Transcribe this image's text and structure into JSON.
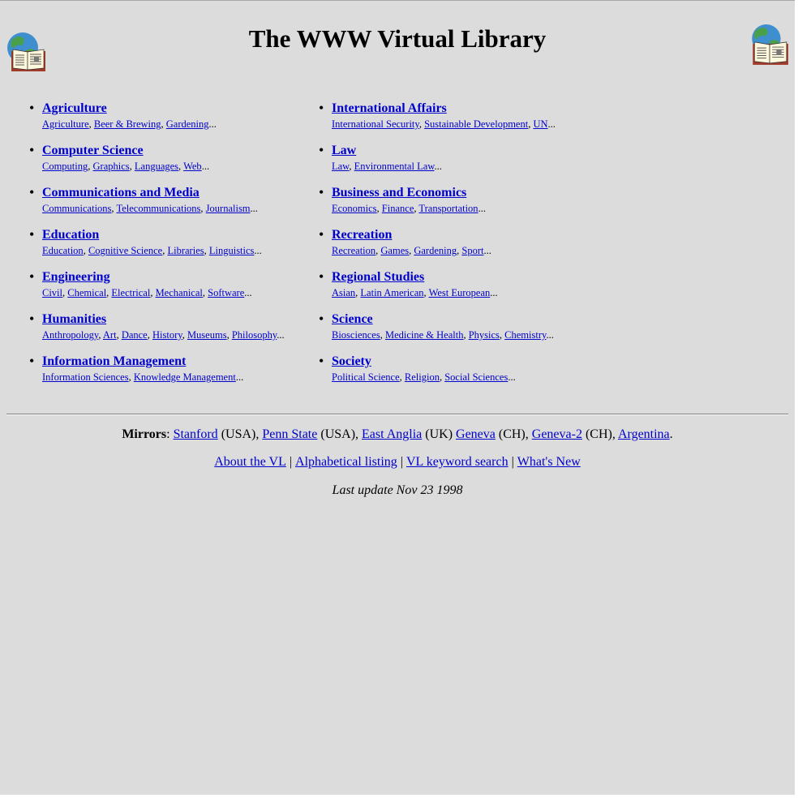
{
  "title": "The WWW Virtual Library",
  "icons": {
    "left": "globe-book-icon",
    "right": "globe-book-icon"
  },
  "colors": {
    "background": "#dcdcdc",
    "link": "#0000cc"
  },
  "categories_left": [
    {
      "title": "Agriculture",
      "subs": [
        "Agriculture",
        "Beer & Brewing",
        "Gardening"
      ]
    },
    {
      "title": "Computer Science",
      "subs": [
        "Computing",
        "Graphics",
        "Languages",
        "Web"
      ]
    },
    {
      "title": "Communications and Media",
      "subs": [
        "Communications",
        "Telecommunications",
        "Journalism"
      ]
    },
    {
      "title": "Education",
      "subs": [
        "Education",
        "Cognitive Science",
        "Libraries",
        "Linguistics"
      ]
    },
    {
      "title": "Engineering",
      "subs": [
        "Civil",
        "Chemical",
        "Electrical",
        "Mechanical",
        "Software"
      ]
    },
    {
      "title": "Humanities",
      "subs": [
        "Anthropology",
        "Art",
        "Dance",
        "History",
        "Museums",
        "Philosophy"
      ]
    },
    {
      "title": "Information Management",
      "subs": [
        "Information Sciences",
        "Knowledge Management"
      ]
    }
  ],
  "categories_right": [
    {
      "title": "International Affairs",
      "subs": [
        "International Security",
        "Sustainable Development",
        "UN"
      ]
    },
    {
      "title": "Law",
      "subs": [
        "Law",
        "Environmental Law"
      ]
    },
    {
      "title": "Business and Economics",
      "subs": [
        "Economics",
        "Finance",
        "Transportation"
      ]
    },
    {
      "title": "Recreation",
      "subs": [
        "Recreation",
        "Games",
        "Gardening",
        "Sport"
      ]
    },
    {
      "title": "Regional Studies",
      "subs": [
        "Asian",
        "Latin American",
        "West European"
      ]
    },
    {
      "title": "Science",
      "subs": [
        "Biosciences",
        "Medicine & Health",
        "Physics",
        "Chemistry"
      ]
    },
    {
      "title": "Society",
      "subs": [
        "Political Science",
        "Religion",
        "Social Sciences"
      ]
    }
  ],
  "mirrors": {
    "label": "Mirrors",
    "items": [
      {
        "name": "Stanford",
        "region": "(USA),"
      },
      {
        "name": "Penn State",
        "region": "(USA),"
      },
      {
        "name": "East Anglia",
        "region": "(UK)"
      },
      {
        "name": "Geneva",
        "region": "(CH),"
      },
      {
        "name": "Geneva-2",
        "region": "(CH),"
      },
      {
        "name": "Argentina",
        "region": "."
      }
    ]
  },
  "nav": [
    "About the VL",
    "Alphabetical listing",
    "VL keyword search",
    "What's New"
  ],
  "last_update": "Last update Nov 23 1998"
}
